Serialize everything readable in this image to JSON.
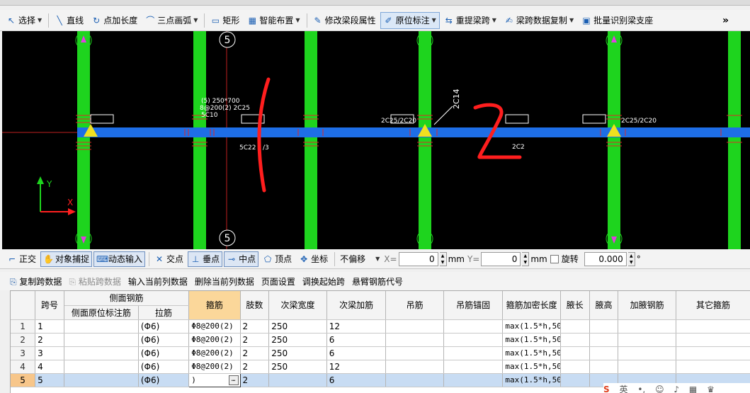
{
  "toolbar": {
    "items": [
      {
        "icon": "select-icon",
        "label": "选择",
        "caret": true
      },
      {
        "icon": "line-icon",
        "label": "直线"
      },
      {
        "icon": "point-length-icon",
        "label": "点加长度"
      },
      {
        "icon": "arc-icon",
        "label": "三点画弧",
        "caret": true
      },
      {
        "icon": "rect-icon",
        "label": "矩形"
      },
      {
        "icon": "smart-layout-icon",
        "label": "智能布置",
        "caret": true
      },
      {
        "icon": "edit-span-icon",
        "label": "修改梁段属性"
      },
      {
        "icon": "in-place-label-icon",
        "label": "原位标注",
        "caret": true,
        "active": true
      },
      {
        "icon": "reextract-span-icon",
        "label": "重提梁跨",
        "caret": true
      },
      {
        "icon": "copy-span-data-icon",
        "label": "梁跨数据复制",
        "caret": true
      },
      {
        "icon": "batch-identify-icon",
        "label": "批量识别梁支座"
      }
    ],
    "more": "»"
  },
  "canvas": {
    "axis_top": "5",
    "axis_bottom": "5",
    "labels": {
      "section": "(5) 250*700",
      "stirrup": "8@200(2) 2C25",
      "side": "5C10",
      "bottom_rebar": "5C22",
      "bottom_suffix": "/3",
      "top_left_support": "2C25/2C20",
      "diag": "2C14",
      "mid_bottom": "2C2",
      "top_right_support": "2C25/2C20"
    },
    "ucs_y": "Y",
    "ucs_x": "X"
  },
  "snapbar": {
    "items": [
      {
        "icon": "ortho-icon",
        "label": "正交",
        "on": false
      },
      {
        "icon": "snap-icon",
        "label": "对象捕捉",
        "on": true
      },
      {
        "icon": "dynamic-input-icon",
        "label": "动态输入",
        "on": true
      },
      {
        "icon": "intersection-icon",
        "label": "交点",
        "on": false
      },
      {
        "icon": "perpendicular-icon",
        "label": "垂点",
        "on": true
      },
      {
        "icon": "midpoint-icon",
        "label": "中点",
        "on": true
      },
      {
        "icon": "vertex-icon",
        "label": "顶点",
        "on": false
      },
      {
        "icon": "coordinate-icon",
        "label": "坐标",
        "on": false
      }
    ],
    "offset_select": "不偏移",
    "x_label": "X=",
    "x_value": "0",
    "y_label": "Y=",
    "y_value": "0",
    "unit": "mm",
    "rotate_label": "旋转",
    "rotate_value": "0.000",
    "degree": "°"
  },
  "panelbar": {
    "items": [
      {
        "label": "复制跨数据",
        "disabled": false
      },
      {
        "label": "粘贴跨数据",
        "disabled": true
      },
      {
        "label": "输入当前列数据",
        "disabled": false
      },
      {
        "label": "删除当前列数据",
        "disabled": false
      },
      {
        "label": "页面设置",
        "disabled": false
      },
      {
        "label": "调换起始跨",
        "disabled": false
      },
      {
        "label": "悬臂钢筋代号",
        "disabled": false
      }
    ]
  },
  "table": {
    "group_header": "侧面钢筋",
    "headers": [
      "跨号",
      "侧面原位标注筋",
      "拉筋",
      "箍筋",
      "肢数",
      "次梁宽度",
      "次梁加筋",
      "吊筋",
      "吊筋锚固",
      "箍筋加密长度",
      "腋长",
      "腋高",
      "加腋钢筋",
      "其它箍筋"
    ],
    "rows": [
      {
        "num": "1",
        "cells": [
          "1",
          "",
          "(Φ6)",
          "Φ8@200(2)",
          "2",
          "250",
          "12",
          "",
          "",
          "max(1.5*h,50",
          "",
          "",
          "",
          ""
        ]
      },
      {
        "num": "2",
        "cells": [
          "2",
          "",
          "(Φ6)",
          "Φ8@200(2)",
          "2",
          "250",
          "6",
          "",
          "",
          "max(1.5*h,50",
          "",
          "",
          "",
          ""
        ]
      },
      {
        "num": "3",
        "cells": [
          "3",
          "",
          "(Φ6)",
          "Φ8@200(2)",
          "2",
          "250",
          "6",
          "",
          "",
          "max(1.5*h,50",
          "",
          "",
          "",
          ""
        ]
      },
      {
        "num": "4",
        "cells": [
          "4",
          "",
          "(Φ6)",
          "Φ8@200(2)",
          "2",
          "250",
          "12",
          "",
          "",
          "max(1.5*h,50",
          "",
          "",
          "",
          ""
        ]
      },
      {
        "num": "5",
        "cells": [
          "5",
          "",
          "(Φ6)",
          ")",
          "2",
          "",
          "6",
          "",
          "",
          "max(1.5*h,50",
          "",
          "",
          "",
          ""
        ],
        "selected": true
      }
    ]
  },
  "ime": {
    "label": "英"
  }
}
